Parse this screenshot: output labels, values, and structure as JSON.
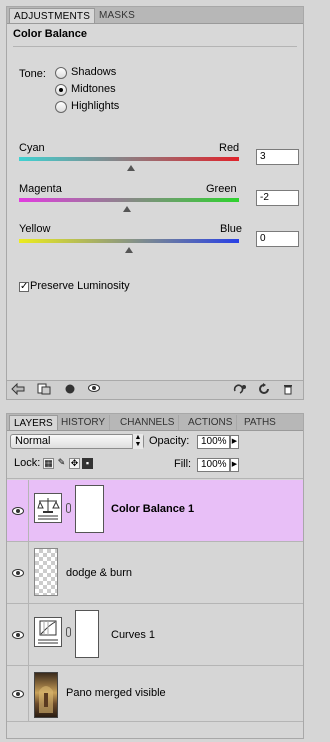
{
  "adjustments": {
    "tabs": [
      "ADJUSTMENTS",
      "MASKS"
    ],
    "title": "Color Balance",
    "tone_label": "Tone:",
    "tone_options": [
      "Shadows",
      "Midtones",
      "Highlights"
    ],
    "selected_tone": "Midtones",
    "sliders": [
      {
        "left": "Cyan",
        "right": "Red",
        "value": "3",
        "level": 0.51
      },
      {
        "left": "Magenta",
        "right": "Green",
        "value": "-2",
        "level": 0.49
      },
      {
        "left": "Yellow",
        "right": "Blue",
        "value": "0",
        "level": 0.5
      }
    ],
    "preserve_luminosity": {
      "label": "Preserve Luminosity",
      "checked": true
    },
    "bottom_icons": [
      "back-arrow-icon",
      "clip-to-layer-icon",
      "visibility-icon",
      "view-previous-icon",
      "reset-icon",
      "refresh-icon",
      "trash-icon"
    ]
  },
  "layers": {
    "tabs": [
      "LAYERS",
      "HISTORY",
      "CHANNELS",
      "ACTIONS",
      "PATHS"
    ],
    "blend_mode": "Normal",
    "opacity_label": "Opacity:",
    "opacity_value": "100%",
    "lock_label": "Lock:",
    "fill_label": "Fill:",
    "fill_value": "100%",
    "items": [
      {
        "name": "Color Balance 1",
        "selected": true
      },
      {
        "name": "dodge & burn",
        "selected": false
      },
      {
        "name": "Curves 1",
        "selected": false
      },
      {
        "name": "Pano merged visible",
        "selected": false
      }
    ]
  },
  "colors": {
    "selected_row": "#e8bff7",
    "cyan": "#3fd2d2",
    "red": "#e0232b",
    "magenta": "#e23ce0",
    "green": "#2ed32e",
    "yellow": "#ecec1e",
    "blue": "#2840e6"
  }
}
